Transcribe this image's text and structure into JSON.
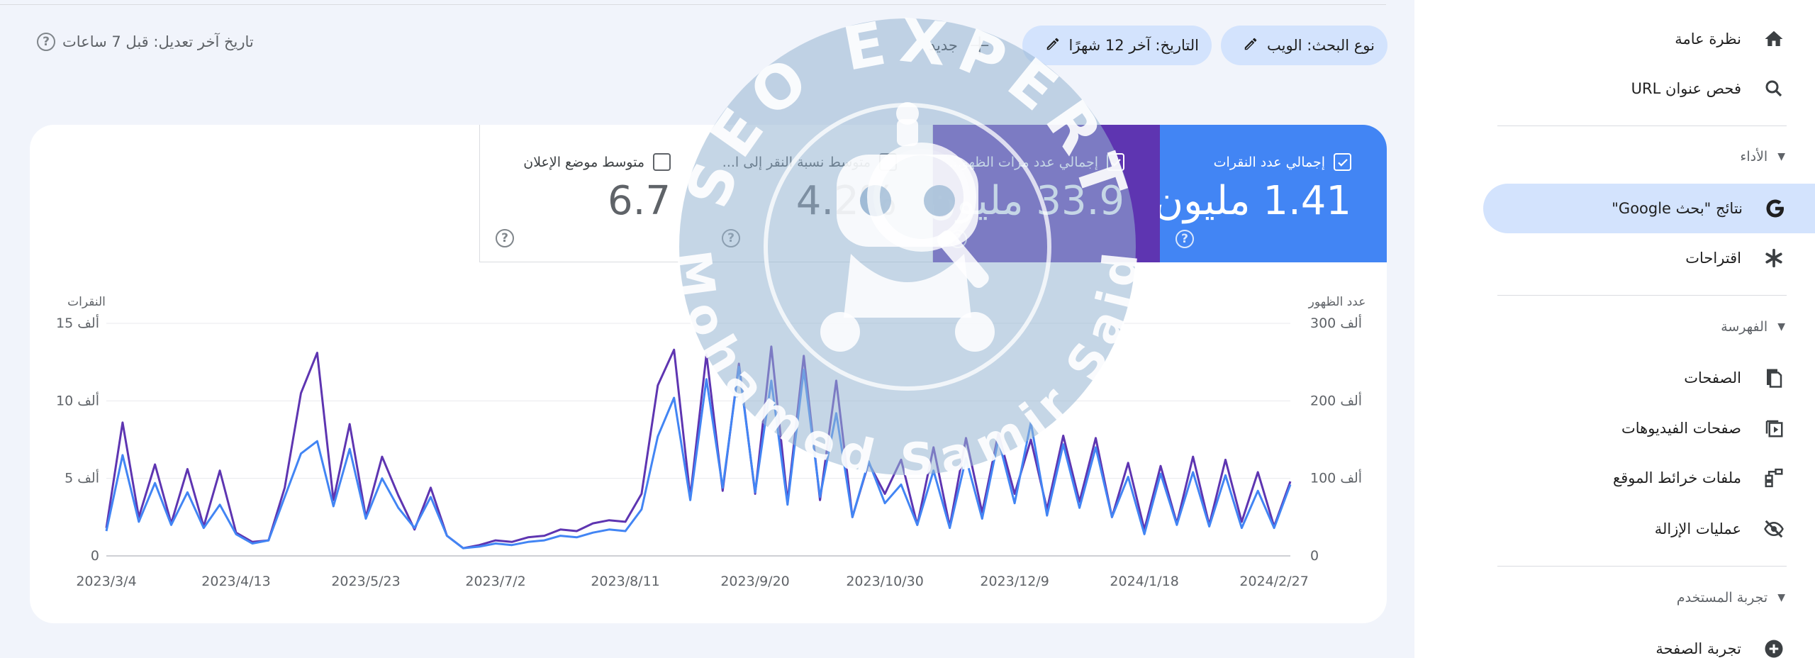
{
  "header": {
    "search_type_chip": "نوع البحث: الويب",
    "date_chip": "التاريخ: آخر 12 شهرًا",
    "new_label": "جديد",
    "last_updated": "تاريخ آخر تعديل: قبل 7 ساعات"
  },
  "metrics": {
    "clicks": {
      "label": "إجمالي عدد النقرات",
      "value": "1.41 مليون",
      "checked": true,
      "color": "#4285f4"
    },
    "impressions": {
      "label": "إجمالي عدد مرات الظهو...",
      "value": "33.9 مليون",
      "checked": true,
      "color": "#5e35b1"
    },
    "ctr": {
      "label": "متوسط نسبة النقر إلى ا...",
      "value": "4.2%",
      "checked": false
    },
    "position": {
      "label": "متوسط موضع الإعلان",
      "value": "6.7",
      "checked": false
    }
  },
  "chart_data": {
    "type": "line",
    "left_axis_title": "النقرات",
    "right_axis_title": "عدد الظهور",
    "left_ticks": [
      "0",
      "5 ألف",
      "10 ألف",
      "15 ألف"
    ],
    "right_ticks": [
      "0",
      "100 ألف",
      "200 ألف",
      "300 ألف"
    ],
    "x_tick_labels": [
      "2023/3/4",
      "2023/4/13",
      "2023/5/23",
      "2023/7/2",
      "2023/8/11",
      "2023/9/20",
      "2023/10/30",
      "2023/12/9",
      "2024/1/18",
      "2024/2/27"
    ],
    "x_range": [
      "2023/3/4",
      "2024/3/3"
    ],
    "left_ylim": [
      0,
      15000
    ],
    "right_ylim": [
      0,
      300000
    ],
    "grid": true,
    "series": [
      {
        "name": "النقرات",
        "axis": "left",
        "color": "#4285f4",
        "x": [
          "2023/3/4",
          "2023/3/9",
          "2023/3/14",
          "2023/3/19",
          "2023/3/24",
          "2023/3/29",
          "2023/4/3",
          "2023/4/8",
          "2023/4/13",
          "2023/4/18",
          "2023/4/23",
          "2023/4/28",
          "2023/5/3",
          "2023/5/8",
          "2023/5/13",
          "2023/5/18",
          "2023/5/23",
          "2023/5/28",
          "2023/6/2",
          "2023/6/7",
          "2023/6/12",
          "2023/6/17",
          "2023/6/22",
          "2023/6/27",
          "2023/7/2",
          "2023/7/7",
          "2023/7/12",
          "2023/7/17",
          "2023/7/22",
          "2023/7/27",
          "2023/8/1",
          "2023/8/6",
          "2023/8/11",
          "2023/8/16",
          "2023/8/21",
          "2023/8/26",
          "2023/8/31",
          "2023/9/5",
          "2023/9/10",
          "2023/9/15",
          "2023/9/20",
          "2023/9/25",
          "2023/9/30",
          "2023/10/5",
          "2023/10/10",
          "2023/10/15",
          "2023/10/20",
          "2023/10/25",
          "2023/10/30",
          "2023/11/4",
          "2023/11/9",
          "2023/11/14",
          "2023/11/19",
          "2023/11/24",
          "2023/11/29",
          "2023/12/4",
          "2023/12/9",
          "2023/12/14",
          "2023/12/19",
          "2023/12/24",
          "2023/12/29",
          "2024/1/3",
          "2024/1/8",
          "2024/1/13",
          "2024/1/18",
          "2024/1/23",
          "2024/1/28",
          "2024/2/2",
          "2024/2/7",
          "2024/2/12",
          "2024/2/17",
          "2024/2/22",
          "2024/2/27",
          "2024/3/3"
        ],
        "values": [
          1600,
          6500,
          2200,
          4700,
          2000,
          4100,
          1800,
          3300,
          1400,
          800,
          1000,
          3800,
          6600,
          7400,
          3200,
          6900,
          2400,
          5000,
          3100,
          1800,
          3800,
          1300,
          500,
          600,
          800,
          700,
          900,
          1000,
          1300,
          1200,
          1500,
          1700,
          1600,
          3000,
          7700,
          10200,
          3600,
          11400,
          4400,
          12200,
          4100,
          11300,
          3300,
          12000,
          3800,
          9200,
          2500,
          6100,
          3400,
          4600,
          2000,
          5500,
          1800,
          6300,
          2400,
          7500,
          3400,
          8600,
          2600,
          7200,
          3100,
          7000,
          2500,
          5100,
          1400,
          5300,
          2000,
          5400,
          1900,
          5200,
          1800,
          4200,
          1800,
          4600
        ]
      },
      {
        "name": "مرات الظهور",
        "axis": "right",
        "color": "#5e35b1",
        "x": [
          "2023/3/4",
          "2023/3/9",
          "2023/3/14",
          "2023/3/19",
          "2023/3/24",
          "2023/3/29",
          "2023/4/3",
          "2023/4/8",
          "2023/4/13",
          "2023/4/18",
          "2023/4/23",
          "2023/4/28",
          "2023/5/3",
          "2023/5/8",
          "2023/5/13",
          "2023/5/18",
          "2023/5/23",
          "2023/5/28",
          "2023/6/2",
          "2023/6/7",
          "2023/6/12",
          "2023/6/17",
          "2023/6/22",
          "2023/6/27",
          "2023/7/2",
          "2023/7/7",
          "2023/7/12",
          "2023/7/17",
          "2023/7/22",
          "2023/7/27",
          "2023/8/1",
          "2023/8/6",
          "2023/8/11",
          "2023/8/16",
          "2023/8/21",
          "2023/8/26",
          "2023/8/31",
          "2023/9/5",
          "2023/9/10",
          "2023/9/15",
          "2023/9/20",
          "2023/9/25",
          "2023/9/30",
          "2023/10/5",
          "2023/10/10",
          "2023/10/15",
          "2023/10/20",
          "2023/10/25",
          "2023/10/30",
          "2023/11/4",
          "2023/11/9",
          "2023/11/14",
          "2023/11/19",
          "2023/11/24",
          "2023/11/29",
          "2023/12/4",
          "2023/12/9",
          "2023/12/14",
          "2023/12/19",
          "2023/12/24",
          "2023/12/29",
          "2024/1/3",
          "2024/1/8",
          "2024/1/13",
          "2024/1/18",
          "2024/1/23",
          "2024/1/28",
          "2024/2/2",
          "2024/2/7",
          "2024/2/12",
          "2024/2/17",
          "2024/2/22",
          "2024/2/27",
          "2024/3/3"
        ],
        "values": [
          36000,
          172000,
          50000,
          118000,
          42000,
          112000,
          38000,
          110000,
          30000,
          18000,
          20000,
          88000,
          210000,
          262000,
          72000,
          170000,
          50000,
          128000,
          78000,
          34000,
          88000,
          26000,
          10000,
          14000,
          20000,
          18000,
          24000,
          26000,
          34000,
          32000,
          42000,
          46000,
          44000,
          80000,
          220000,
          266000,
          76000,
          260000,
          84000,
          248000,
          80000,
          270000,
          70000,
          258000,
          72000,
          226000,
          50000,
          120000,
          80000,
          124000,
          40000,
          140000,
          38000,
          152000,
          56000,
          158000,
          80000,
          150000,
          60000,
          155000,
          70000,
          152000,
          50000,
          120000,
          34000,
          116000,
          42000,
          128000,
          40000,
          124000,
          44000,
          108000,
          38000,
          96000
        ]
      }
    ]
  },
  "sidebar": {
    "overview": "نظرة عامة",
    "url_inspection": "فحص عنوان URL",
    "performance_section": "الأداء",
    "google_search": "نتائج \"بحث Google\"",
    "suggestions": "اقتراحات",
    "indexing_section": "الفهرسة",
    "pages": "الصفحات",
    "video_pages": "صفحات الفيديوهات",
    "sitemaps": "ملفات خرائط الموقع",
    "removals": "عمليات الإزالة",
    "experience_section": "تجربة المستخدم",
    "page_experience": "تجربة الصفحة"
  },
  "watermark": {
    "top_text": "SEO EXPERT",
    "bottom_text": "Mohamed Samir Said"
  }
}
